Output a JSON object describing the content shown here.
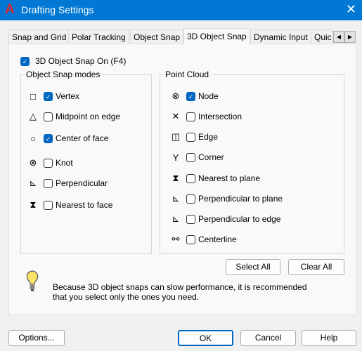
{
  "window": {
    "title": "Drafting Settings",
    "logo": "A",
    "close_icon": "close-icon"
  },
  "tabs": [
    {
      "label": "Snap and Grid"
    },
    {
      "label": "Polar Tracking"
    },
    {
      "label": "Object Snap"
    },
    {
      "label": "3D Object Snap",
      "active": true
    },
    {
      "label": "Dynamic Input"
    },
    {
      "label": "Quic"
    }
  ],
  "snap_on": {
    "label": "3D Object Snap On (F4)",
    "checked": true
  },
  "object_snap_modes": {
    "title": "Object Snap modes",
    "items": [
      {
        "label": "Vertex",
        "checked": true,
        "icon": "□"
      },
      {
        "label": "Midpoint on edge",
        "checked": false,
        "icon": "△"
      },
      {
        "label": "Center of face",
        "checked": true,
        "icon": "○"
      },
      {
        "label": "Knot",
        "checked": false,
        "icon": "⊗"
      },
      {
        "label": "Perpendicular",
        "checked": false,
        "icon": "⊾"
      },
      {
        "label": "Nearest to face",
        "checked": false,
        "icon": "⧗"
      }
    ]
  },
  "point_cloud": {
    "title": "Point Cloud",
    "items": [
      {
        "label": "Node",
        "checked": true,
        "icon": "⊗"
      },
      {
        "label": "Intersection",
        "checked": false,
        "icon": "✕"
      },
      {
        "label": "Edge",
        "checked": false,
        "icon": "◫"
      },
      {
        "label": "Corner",
        "checked": false,
        "icon": "Y"
      },
      {
        "label": "Nearest to plane",
        "checked": false,
        "icon": "⧗"
      },
      {
        "label": "Perpendicular to plane",
        "checked": false,
        "icon": "⊾"
      },
      {
        "label": "Perpendicular to edge",
        "checked": false,
        "icon": "⊾"
      },
      {
        "label": "Centerline",
        "checked": false,
        "icon": "⚯"
      }
    ]
  },
  "select_all": "Select All",
  "clear_all": "Clear All",
  "info": {
    "line1": "Because 3D object snaps can slow performance, it is recommended",
    "line2": "that you select only the ones you need."
  },
  "footer": {
    "options": "Options...",
    "ok": "OK",
    "cancel": "Cancel",
    "help": "Help"
  }
}
